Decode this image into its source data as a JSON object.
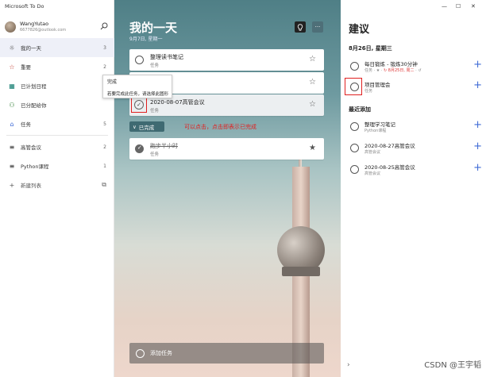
{
  "app": {
    "title": "Microsoft To Do"
  },
  "profile": {
    "name": "WangYutao",
    "email": "6677826@outlook.com"
  },
  "sidebar": {
    "items": [
      {
        "icon": "☼",
        "label": "我的一天",
        "count": "3",
        "active": true,
        "color": "#555"
      },
      {
        "icon": "☆",
        "label": "重要",
        "count": "2",
        "color": "#c0392b"
      },
      {
        "icon": "▦",
        "label": "已计划日程",
        "count": "",
        "color": "#0e7a6e"
      },
      {
        "icon": "⚇",
        "label": "已分配给你",
        "count": "",
        "color": "#2e7d32"
      },
      {
        "icon": "⌂",
        "label": "任务",
        "count": "5",
        "color": "#3f6bd6"
      }
    ],
    "lists": [
      {
        "icon": "≡",
        "label": "高管会议",
        "count": "2"
      },
      {
        "icon": "≡",
        "label": "Python课程",
        "count": "1"
      }
    ],
    "new_list": "新建列表"
  },
  "tooltip": {
    "line1": "完成",
    "line2": "若要完成此任务，请选择此圆形"
  },
  "main": {
    "title": "我的一天",
    "date": "9月7日, 星期一",
    "tasks": [
      {
        "name": "整理读书笔记",
        "sub": "任务"
      },
      {
        "name": "",
        "sub": ""
      },
      {
        "name": "2020-08-07高管会议",
        "sub": "任务"
      }
    ],
    "completed_label": "已完成",
    "completed_tasks": [
      {
        "name": "跑步半小时",
        "sub": "任务"
      }
    ],
    "note": "可以点击，点击即表示已完成",
    "add_task": "添加任务"
  },
  "right": {
    "title": "建议",
    "section1": "8月26日, 星期三",
    "suggestions1": [
      {
        "name": "每日锻炼 - 锻炼30分钟",
        "sub_prefix": "任务 · ★ · ",
        "sub_red": "↻ 8月25日, 周二",
        "sub_suffix": " · ↺"
      },
      {
        "name": "项目管理会",
        "sub_prefix": "任务",
        "sub_red": "",
        "sub_suffix": ""
      }
    ],
    "section2": "最近添加",
    "suggestions2": [
      {
        "name": "整理学习笔记",
        "sub_prefix": "Python课程",
        "sub_red": "",
        "sub_suffix": ""
      },
      {
        "name": "2020-08-27高管会议",
        "sub_prefix": "高管会议",
        "sub_red": "",
        "sub_suffix": ""
      },
      {
        "name": "2020-08-25高管会议",
        "sub_prefix": "高管会议",
        "sub_red": "",
        "sub_suffix": ""
      }
    ]
  },
  "watermark": "CSDN @王宇韬",
  "colors": {
    "accent": "#3f6bd6",
    "annotation": "#e02020"
  }
}
